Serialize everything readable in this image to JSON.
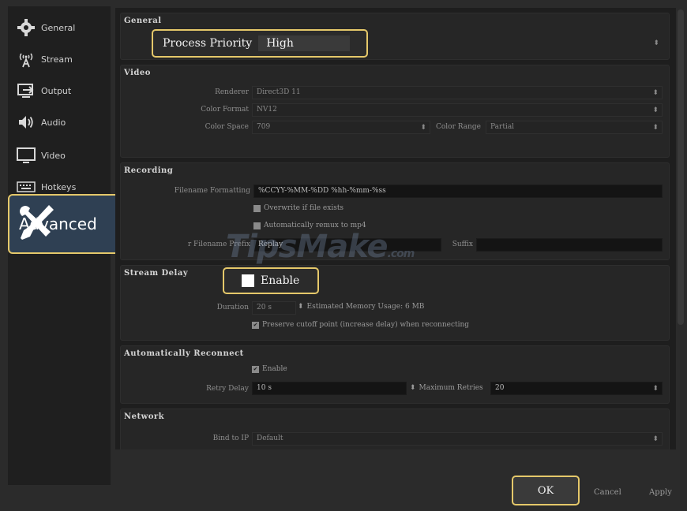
{
  "sidebar": {
    "items": [
      {
        "label": "General",
        "icon": "gear-icon"
      },
      {
        "label": "Stream",
        "icon": "broadcast-icon"
      },
      {
        "label": "Output",
        "icon": "output-icon"
      },
      {
        "label": "Audio",
        "icon": "speaker-icon"
      },
      {
        "label": "Video",
        "icon": "monitor-icon"
      },
      {
        "label": "Hotkeys",
        "icon": "keyboard-icon"
      }
    ],
    "advanced": {
      "label": "Advanced",
      "icon": "tools-icon"
    }
  },
  "general": {
    "title": "General",
    "process_priority_label": "Process Priority",
    "process_priority_value": "High"
  },
  "video": {
    "title": "Video",
    "renderer_label": "Renderer",
    "renderer_value": "Direct3D 11",
    "color_format_label": "Color Format",
    "color_format_value": "NV12",
    "color_space_label": "Color Space",
    "color_space_value": "709",
    "color_range_label": "Color Range",
    "color_range_value": "Partial"
  },
  "recording": {
    "title": "Recording",
    "filename_formatting_label": "Filename Formatting",
    "filename_formatting_value": "%CCYY-%MM-%DD %hh-%mm-%ss",
    "overwrite_label": "Overwrite if file exists",
    "remux_label": "Automatically remux to mp4",
    "replay_prefix_label": "r Filename Prefix",
    "replay_prefix_value": "Replay",
    "suffix_label": "Suffix"
  },
  "stream_delay": {
    "title": "Stream Delay",
    "enable_label": "Enable",
    "duration_label": "Duration",
    "duration_value": "20 s",
    "memory_usage": "Estimated Memory Usage: 6 MB",
    "preserve_label": "Preserve cutoff point (increase delay) when reconnecting"
  },
  "reconnect": {
    "title": "Automatically Reconnect",
    "enable_label": "Enable",
    "retry_delay_label": "Retry Delay",
    "retry_delay_value": "10 s",
    "max_retries_label": "Maximum Retries",
    "max_retries_value": "20"
  },
  "network": {
    "title": "Network",
    "bind_label": "Bind to IP",
    "bind_value": "Default"
  },
  "buttons": {
    "ok": "OK",
    "cancel": "Cancel",
    "apply": "Apply"
  },
  "watermark": {
    "main": "TipsMake",
    "suffix": ".com"
  },
  "colors": {
    "highlight": "#e5c86a",
    "selected_bg": "#2f4053"
  }
}
